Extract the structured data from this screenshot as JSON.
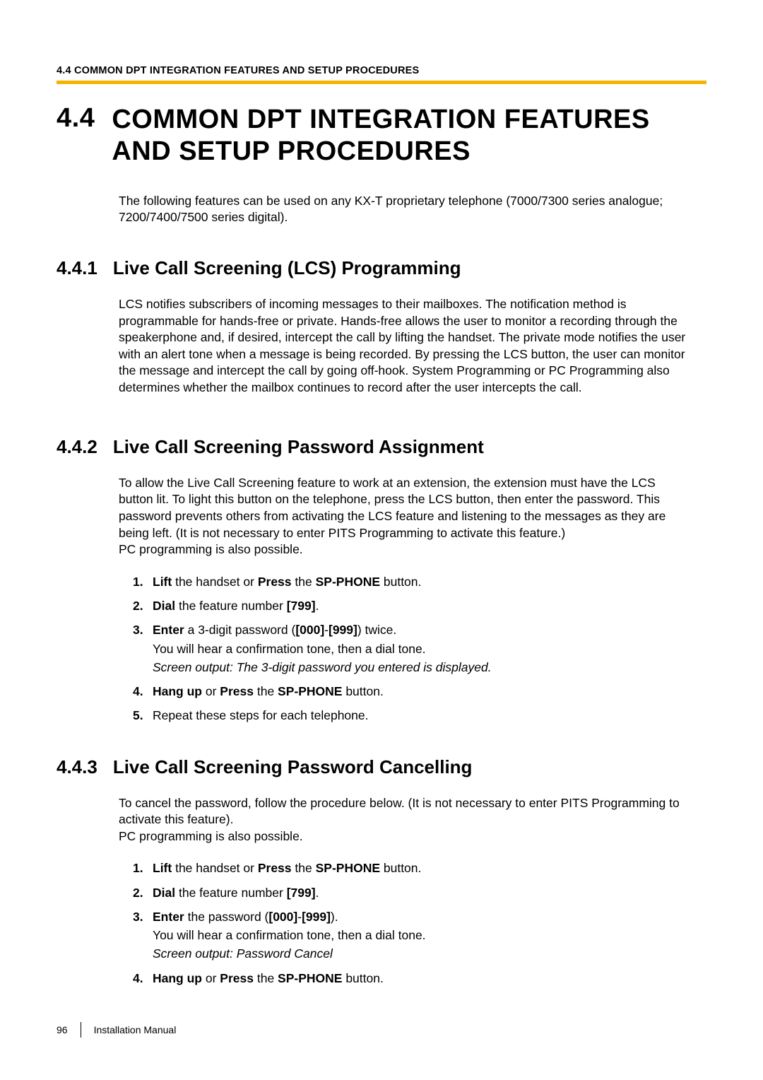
{
  "runningHead": "4.4 COMMON DPT INTEGRATION FEATURES AND SETUP PROCEDURES",
  "h1": {
    "num": "4.4",
    "title": "COMMON DPT INTEGRATION FEATURES AND SETUP PROCEDURES"
  },
  "intro": "The following features can be used on any KX-T proprietary telephone (7000/7300 series analogue; 7200/7400/7500 series digital).",
  "s441": {
    "num": "4.4.1",
    "title": "Live Call Screening (LCS) Programming",
    "para": "LCS notifies subscribers of incoming messages to their mailboxes. The notification method is programmable for hands-free or private. Hands-free allows the user to monitor a recording through the speakerphone and, if desired, intercept the call by lifting the handset. The private mode notifies the user with an alert tone when a message is being recorded. By pressing the LCS button, the user can monitor the message and intercept the call by going off-hook. System Programming or PC Programming also determines whether the mailbox continues to record after the user intercepts the call."
  },
  "s442": {
    "num": "4.4.2",
    "title": "Live Call Screening Password Assignment",
    "para": "To allow the Live Call Screening feature to work at an extension, the extension must have the LCS button lit. To light this button on the telephone, press the LCS button, then enter the password. This password prevents others from activating the LCS feature and listening to the messages as they are being left. (It is not necessary to enter PITS Programming to activate this feature.)\nPC programming is also possible.",
    "steps": {
      "s1": {
        "a": "Lift",
        "b": " the handset or ",
        "c": "Press",
        "d": " the ",
        "e": "SP-PHONE",
        "f": " button."
      },
      "s2": {
        "a": "Dial",
        "b": " the feature number ",
        "c": "[799]",
        "d": "."
      },
      "s3": {
        "a": "Enter",
        "b": " a 3-digit password (",
        "c": "[000]",
        "d": "-",
        "e": "[999]",
        "f": ") twice.",
        "sub1": "You will hear a confirmation tone, then a dial tone.",
        "sub2": "Screen output: The 3-digit password you entered is displayed."
      },
      "s4": {
        "a": "Hang up",
        "b": " or ",
        "c": "Press",
        "d": " the ",
        "e": "SP-PHONE",
        "f": " button."
      },
      "s5": "Repeat these steps for each telephone."
    }
  },
  "s443": {
    "num": "4.4.3",
    "title": "Live Call Screening Password Cancelling",
    "para": "To cancel the password, follow the procedure below. (It is not necessary to enter PITS Programming to activate this feature).\nPC programming is also possible.",
    "steps": {
      "s1": {
        "a": "Lift",
        "b": " the handset or ",
        "c": "Press",
        "d": " the ",
        "e": "SP-PHONE",
        "f": " button."
      },
      "s2": {
        "a": "Dial",
        "b": " the feature number ",
        "c": "[799]",
        "d": "."
      },
      "s3": {
        "a": "Enter",
        "b": " the password (",
        "c": "[000]",
        "d": "-",
        "e": "[999]",
        "f": ").",
        "sub1": "You will hear a confirmation tone, then a dial tone.",
        "sub2": "Screen output: Password Cancel"
      },
      "s4": {
        "a": "Hang up",
        "b": " or ",
        "c": "Press",
        "d": " the ",
        "e": "SP-PHONE",
        "f": " button."
      }
    }
  },
  "footer": {
    "page": "96",
    "label": "Installation Manual"
  }
}
